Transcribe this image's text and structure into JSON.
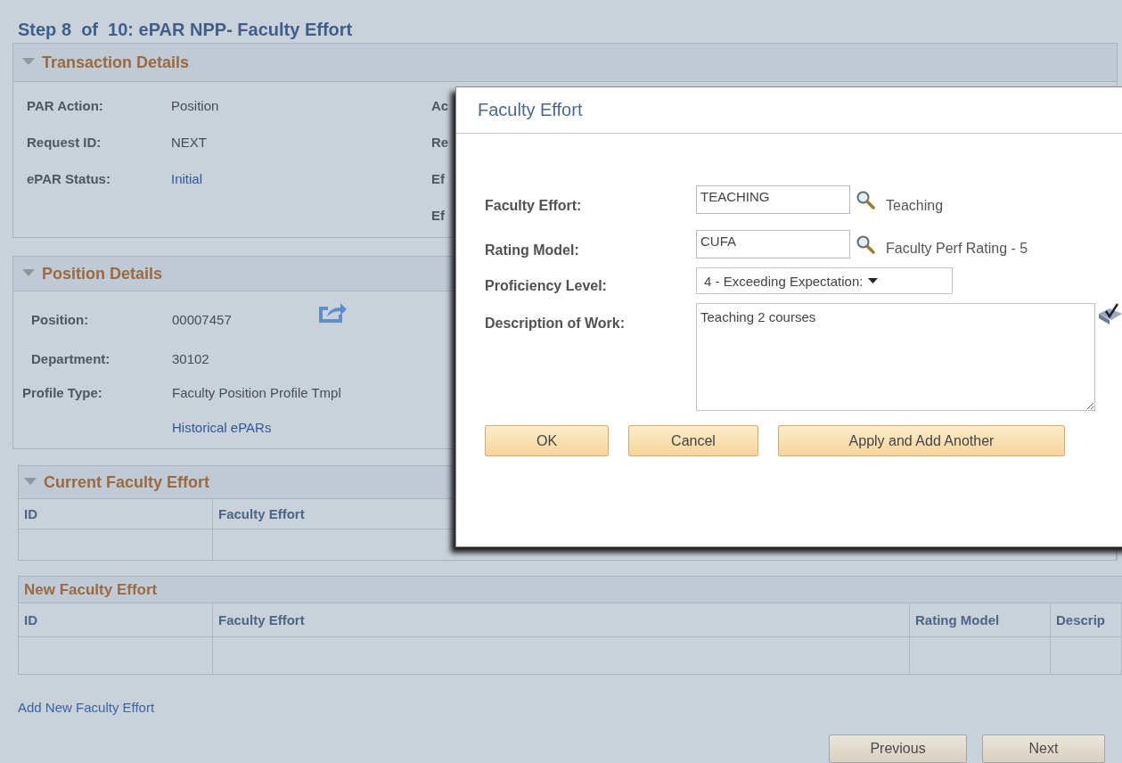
{
  "page_title": "Step 8  of  10: ePAR NPP- Faculty Effort",
  "transaction_details": {
    "title": "Transaction Details",
    "expanded": true,
    "fields": [
      {
        "label": "PAR Action:",
        "value": "Position",
        "kind": "text"
      },
      {
        "label": "Request ID:",
        "value": "NEXT",
        "kind": "text"
      },
      {
        "label": "ePAR Status:",
        "value": "Initial",
        "kind": "link"
      }
    ],
    "second_column_labels": [
      "Ac",
      "Re",
      "Ef",
      "Ef"
    ]
  },
  "position_details": {
    "title": "Position Details",
    "expanded": true,
    "fields": [
      {
        "label": "Position:",
        "value": "00007457",
        "kind": "share"
      },
      {
        "label": "Department:",
        "value": "30102",
        "kind": "text"
      },
      {
        "label": "Profile Type:",
        "value": "Faculty Position Profile Tmpl",
        "kind": "text"
      },
      {
        "value": "Historical ePARs",
        "kind": "link"
      }
    ]
  },
  "current_faculty_effort": {
    "title": "Current Faculty Effort",
    "expanded": true,
    "columns": [
      "ID",
      "Faculty Effort"
    ]
  },
  "new_faculty_effort": {
    "title": "New Faculty Effort",
    "columns": [
      "ID",
      "Faculty Effort",
      "Rating Model",
      "Descrip"
    ]
  },
  "add_link": "Add New Faculty Effort",
  "nav_buttons": [
    "Previous",
    "Next"
  ],
  "dialog": {
    "title": "Faculty Effort",
    "fields": [
      {
        "label": "Faculty Effort:",
        "kind": "lookup",
        "value": "TEACHING",
        "description": "Teaching"
      },
      {
        "label": "Rating Model:",
        "kind": "lookup",
        "value": "CUFA",
        "description": "Faculty Perf Rating - 5"
      },
      {
        "label": "Proficiency Level:",
        "kind": "select",
        "value": "4 - Exceeding Expectation:"
      },
      {
        "label": "Description of Work:",
        "kind": "textarea",
        "value": "Teaching 2 courses"
      }
    ],
    "buttons": [
      "OK",
      "Cancel",
      "Apply and Add Another"
    ]
  }
}
